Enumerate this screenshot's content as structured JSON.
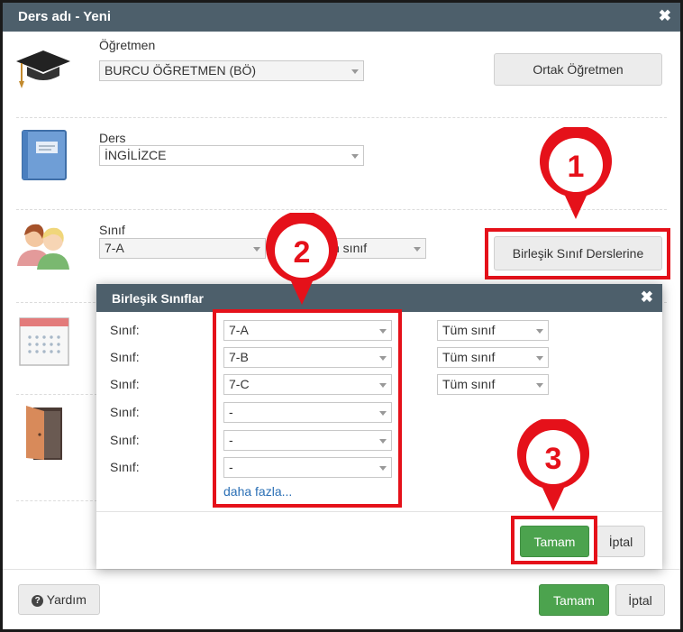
{
  "window": {
    "title": "Ders adı - Yeni",
    "close_symbol": "✖"
  },
  "teacher": {
    "label": "Öğretmen",
    "value": "BURCU ÖĞRETMEN (BÖ)",
    "icon": "graduation-cap-icon",
    "shared_button": "Ortak Öğretmen"
  },
  "subject": {
    "label": "Ders",
    "value": "İNGİLİZCE",
    "icon": "book-icon"
  },
  "class": {
    "label": "Sınıf",
    "value": "7-A",
    "partial_select_visible_text": "n sınıf",
    "icon": "students-icon",
    "combined_button": "Birleşik Sınıf Derslerine"
  },
  "calendar_icon": "calendar-icon",
  "door_icon": "door-icon",
  "footer": {
    "help_icon": "question-circle-icon",
    "help_label": "Yardım",
    "ok_label": "Tamam",
    "cancel_label": "İptal"
  },
  "combined_dialog": {
    "title": "Birleşik Sınıflar",
    "close_symbol": "✖",
    "rows": [
      {
        "label": "Sınıf:",
        "class": "7-A",
        "scope": "Tüm sınıf"
      },
      {
        "label": "Sınıf:",
        "class": "7-B",
        "scope": "Tüm sınıf"
      },
      {
        "label": "Sınıf:",
        "class": "7-C",
        "scope": "Tüm sınıf"
      },
      {
        "label": "Sınıf:",
        "class": "-",
        "scope": ""
      },
      {
        "label": "Sınıf:",
        "class": "-",
        "scope": ""
      },
      {
        "label": "Sınıf:",
        "class": "-",
        "scope": ""
      }
    ],
    "more_link": "daha fazla...",
    "ok_label": "Tamam",
    "cancel_label": "İptal"
  },
  "callouts": [
    {
      "number": "1",
      "color": "#e5111a"
    },
    {
      "number": "2",
      "color": "#e5111a"
    },
    {
      "number": "3",
      "color": "#e5111a"
    }
  ],
  "colors": {
    "titlebar": "#4d5f6b",
    "highlight": "#e5111a",
    "ok_button": "#4ca34e",
    "link": "#2a6fb5"
  }
}
